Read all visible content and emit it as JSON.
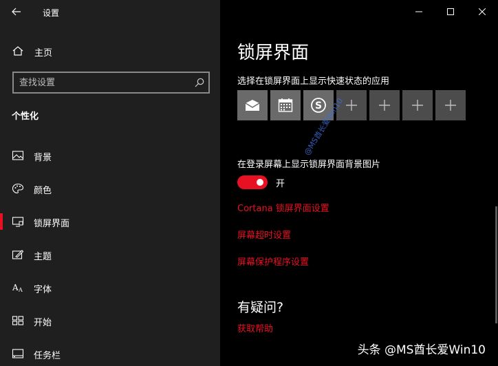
{
  "app": {
    "title": "设置"
  },
  "sidebar": {
    "home_label": "主页",
    "search_placeholder": "查找设置",
    "section_title": "个性化",
    "items": [
      {
        "label": "背景",
        "icon": "picture-icon"
      },
      {
        "label": "颜色",
        "icon": "palette-icon"
      },
      {
        "label": "锁屏界面",
        "icon": "lock-screen-icon",
        "active": true
      },
      {
        "label": "主题",
        "icon": "theme-brush-icon"
      },
      {
        "label": "字体",
        "icon": "font-icon"
      },
      {
        "label": "开始",
        "icon": "start-grid-icon"
      },
      {
        "label": "任务栏",
        "icon": "taskbar-icon"
      }
    ]
  },
  "main": {
    "title": "锁屏界面",
    "quick_status_label": "选择在锁屏界面上显示快速状态的应用",
    "apps": [
      {
        "icon": "mail-icon"
      },
      {
        "icon": "calendar-icon"
      },
      {
        "icon": "skype-icon"
      },
      {
        "icon": "plus-icon"
      },
      {
        "icon": "plus-icon"
      },
      {
        "icon": "plus-icon"
      },
      {
        "icon": "plus-icon"
      }
    ],
    "signin_bg_label": "在登录屏幕上显示锁屏界面背景图片",
    "toggle_state": "开",
    "links": {
      "cortana": "Cortana 锁屏界面设置",
      "timeout": "屏幕超时设置",
      "screensaver": "屏幕保护程序设置"
    },
    "question_title": "有疑问?",
    "help_link": "获取帮助"
  },
  "overlay": {
    "watermark": "@MS酋长爱Win10",
    "brand": "头条 @MS酋长爱Win10"
  },
  "colors": {
    "accent": "#e81123",
    "sidebar_bg": "#1f1f1f",
    "main_bg": "#000000"
  }
}
